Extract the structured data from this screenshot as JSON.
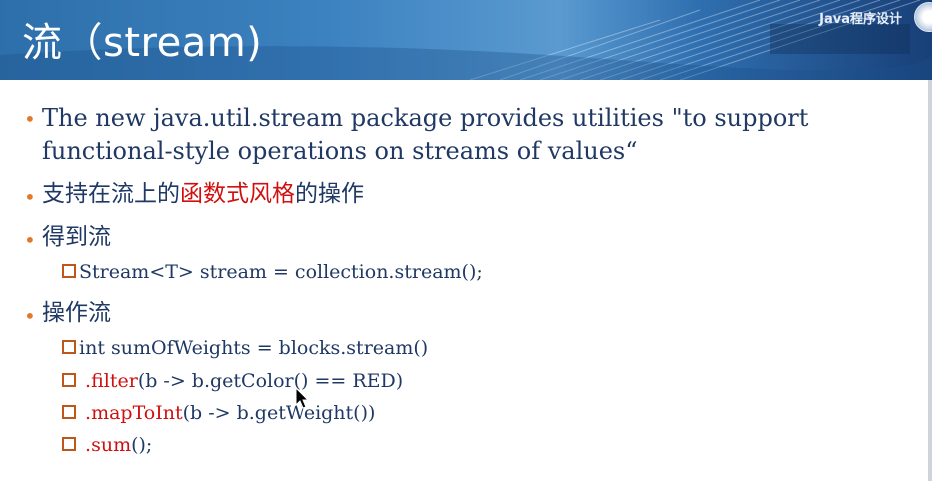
{
  "header": {
    "title": "流（stream)",
    "course_label": "Java程序设计"
  },
  "bullets": [
    {
      "line1": "The new java.util.stream package provides utilities \"to support",
      "line2": "functional-style operations on streams of values“"
    },
    {
      "before": "支持在流上的",
      "highlight": "函数式风格",
      "after": "的操作"
    },
    {
      "text": "得到流"
    },
    {
      "text": "操作流"
    }
  ],
  "sub_items": {
    "get_stream": "Stream<T> stream = collection.stream();",
    "ops": [
      {
        "plain": "int sumOfWeights = blocks.stream()",
        "method": "",
        "rest": ""
      },
      {
        "plain": " ",
        "method": ".filter",
        "rest": "(b -> b.getColor() == RED)"
      },
      {
        "plain": " ",
        "method": ".mapToInt",
        "rest": "(b -> b.getWeight())"
      },
      {
        "plain": " ",
        "method": ".sum",
        "rest": "();"
      }
    ]
  },
  "colors": {
    "bullet": "#e07a2a",
    "text": "#1f3864",
    "highlight": "#d01010",
    "banner": "#2d6faa"
  }
}
